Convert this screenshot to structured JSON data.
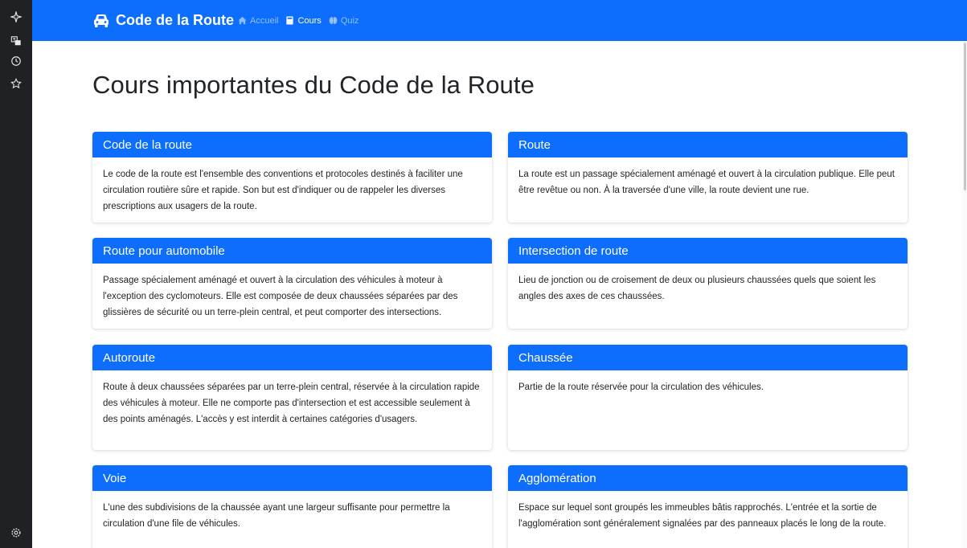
{
  "navbar": {
    "brand": "Code de la Route",
    "links": [
      {
        "label": "Accueil",
        "icon": "home-icon",
        "active": false
      },
      {
        "label": "Cours",
        "icon": "book-icon",
        "active": true
      },
      {
        "label": "Quiz",
        "icon": "brain-icon",
        "active": false
      }
    ]
  },
  "page": {
    "title": "Cours importantes du Code de la Route"
  },
  "cards": [
    {
      "title": "Code de la route",
      "body": "Le code de la route est l'ensemble des conventions et protocoles destinés à faciliter une circulation routière sûre et rapide. Son but est d'indiquer ou de rappeler les diverses prescriptions aux usagers de la route."
    },
    {
      "title": "Route",
      "body": "La route est un passage spécialement aménagé et ouvert à la circulation publique. Elle peut être revêtue ou non. À la traversée d'une ville, la route devient une rue."
    },
    {
      "title": "Route pour automobile",
      "body": "Passage spécialement aménagé et ouvert à la circulation des véhicules à moteur à l'exception des cyclomoteurs. Elle est composée de deux chaussées séparées par des glissières de sécurité ou un terre-plein central, et peut comporter des intersections."
    },
    {
      "title": "Intersection de route",
      "body": "Lieu de jonction ou de croisement de deux ou plusieurs chaussées quels que soient les angles des axes de ces chaussées."
    },
    {
      "title": "Autoroute",
      "body": "Route à deux chaussées séparées par un terre-plein central, réservée à la circulation rapide des véhicules à moteur. Elle ne comporte pas d'intersection et est accessible seulement à des points aménagés. L'accès y est interdit à certaines catégories d'usagers."
    },
    {
      "title": "Chaussée",
      "body": "Partie de la route réservée pour la circulation des véhicules."
    },
    {
      "title": "Voie",
      "body": "L'une des subdivisions de la chaussée ayant une largeur suffisante pour permettre la circulation d'une file de véhicules."
    },
    {
      "title": "Agglomération",
      "body": "Espace sur lequel sont groupés les immeubles bâtis rapprochés. L'entrée et la sortie de l'agglomération sont généralement signalées par des panneaux placés le long de la route."
    }
  ],
  "sidebar": {
    "icons": [
      "sparkle-icon",
      "translate-icon",
      "history-icon",
      "star-icon",
      "settings-icon"
    ]
  },
  "colors": {
    "primary": "#0d6efd",
    "rail": "#202124"
  }
}
